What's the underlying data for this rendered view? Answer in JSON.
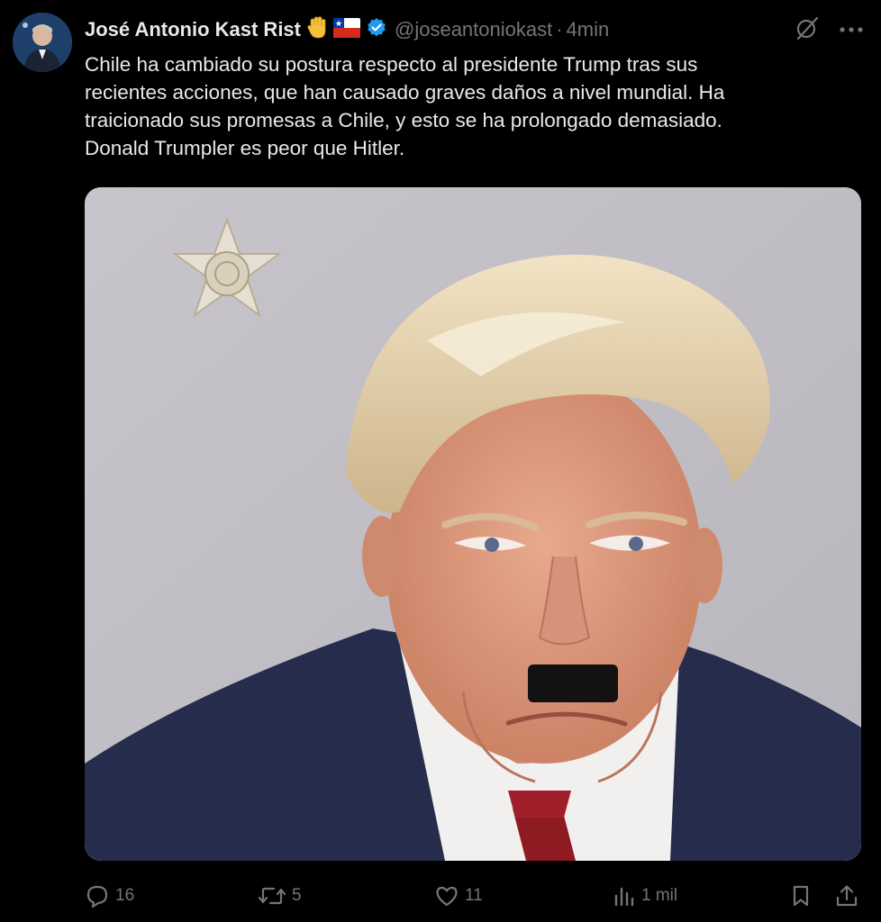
{
  "tweet": {
    "display_name": "José Antonio Kast Rist",
    "handle": "@joseantoniokast",
    "separator": "·",
    "timestamp": "4min",
    "text_lines": [
      "Chile ha cambiado su postura respecto al presidente Trump tras sus",
      "recientes acciones, que han causado graves daños a nivel mundial. Ha",
      "traicionado sus promesas a Chile, y esto se ha prolongado demasiado.",
      "Donald Trumpler es peor que Hitler."
    ],
    "media": {
      "icon": "photo-mugshot",
      "badge_icon": "sheriff-star-badge-icon"
    },
    "header_icons": [
      "grok-icon",
      "more-icon"
    ],
    "name_icons": [
      "waving-hand-icon",
      "chile-flag-icon",
      "verified-badge-icon"
    ]
  },
  "actions": {
    "reply_count": "16",
    "repost_count": "5",
    "like_count": "11",
    "views_count": "1 mil",
    "icons": [
      "reply-icon",
      "repost-icon",
      "like-icon",
      "views-icon",
      "bookmark-icon",
      "share-icon"
    ]
  },
  "colors": {
    "background": "#000000",
    "text_primary": "#e7e9ea",
    "text_secondary": "#71767b",
    "verified_blue": "#1d9bf0"
  }
}
